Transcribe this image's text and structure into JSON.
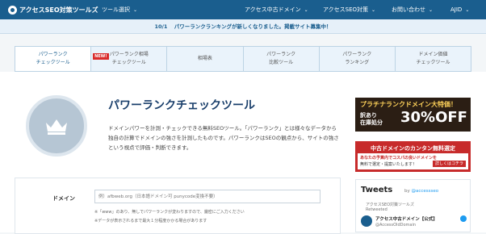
{
  "header": {
    "logo": "アクセスSEO対策ツールズ",
    "nav": [
      {
        "label": "ツール選択"
      },
      {
        "label": "アクセス中古ドメイン"
      },
      {
        "label": "アクセスSEO対策"
      },
      {
        "label": "お問い合わせ"
      },
      {
        "label": "AJID"
      }
    ]
  },
  "notice": {
    "date": "10/1",
    "text": "パワーランクランキングが新しくなりました。掲載サイト募集中！"
  },
  "tabs": [
    {
      "label": "パワーランク\nチェックツール",
      "active": true
    },
    {
      "label": "パワーランク相場\nチェックツール",
      "badge": "NEW!"
    },
    {
      "label": "相場表"
    },
    {
      "label": "パワーランク\n比較ツール"
    },
    {
      "label": "パワーランク\nランキング"
    },
    {
      "label": "ドメイン価値\nチェックツール"
    }
  ],
  "main": {
    "title": "パワーランクチェックツール",
    "description": "ドメインパワーを計測・チェックできる無料SEOツール。「パワーランク」とは様々なデータから独自の計算でドメインの強さを計測したものです。パワーランクはSEOの観点から、サイトの強さという視点で評価・判断できます。",
    "form": {
      "label": "ドメイン",
      "placeholder": "例）afbweb.org（日本語ドメイン可 punycode変換不要）",
      "note1": "※「www」のあり、無しでパワーランクが変わりますので、厳密にご入力ください",
      "note2": "※データが表示されるまで最大１分程度かかる場合があります"
    }
  },
  "ads": {
    "ad1": {
      "line1": "プラチナランクドメイン大特価！",
      "line2": "訳あり\n在庫処分",
      "line3": "30%OFF"
    },
    "ad2": {
      "header": "中古ドメインのカンタン無料選定",
      "sub1": "あなたの予算内でコスパの良いドメインを",
      "sub2": "無料で選定・提案いたします！",
      "button": "詳しくはコチラ"
    }
  },
  "tweets": {
    "title": "Tweets",
    "by": "by",
    "handle": "@accessseo",
    "retweet": "アクセスSEO対策ツールズ\nRetweeted",
    "name": "アクセス中古ドメイン【公式】",
    "account": "@AccessOldDomain"
  }
}
